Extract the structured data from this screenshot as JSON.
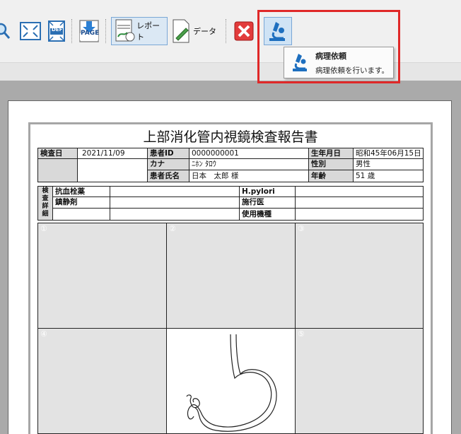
{
  "toolbar": {
    "report_label": "レポート",
    "data_label": "データ",
    "page_label": "PAGE",
    "def_label": "DEF"
  },
  "tooltip": {
    "title": "病理依頼",
    "description": "病理依頼を行います。"
  },
  "report": {
    "title": "上部消化管内視鏡検査報告書",
    "exam_date_label": "検査日",
    "exam_date": "2021/11/09",
    "patient_id_label": "患者ID",
    "patient_id": "0000000001",
    "kana_label": "カナ",
    "kana": "ﾆﾎﾝ ﾀﾛｳ",
    "name_label": "患者氏名",
    "name": "日本　太郎 様",
    "birth_label": "生年月日",
    "birth": "昭和45年06月15日",
    "sex_label": "性別",
    "sex": "男性",
    "age_label": "年齢",
    "age": "51 歳",
    "side_label": [
      "検",
      "査",
      "詳",
      "細"
    ],
    "antithrombotic_label": "抗血栓薬",
    "sedative_label": "鎮静剤",
    "hpylori_label": "H.pylori",
    "operator_label": "施行医",
    "device_label": "使用機種",
    "image_numbers": [
      "①",
      "②",
      "③",
      "④",
      "⑤"
    ]
  },
  "colors": {
    "highlight": "#e02828",
    "page_bg": "#aaaaaa"
  }
}
